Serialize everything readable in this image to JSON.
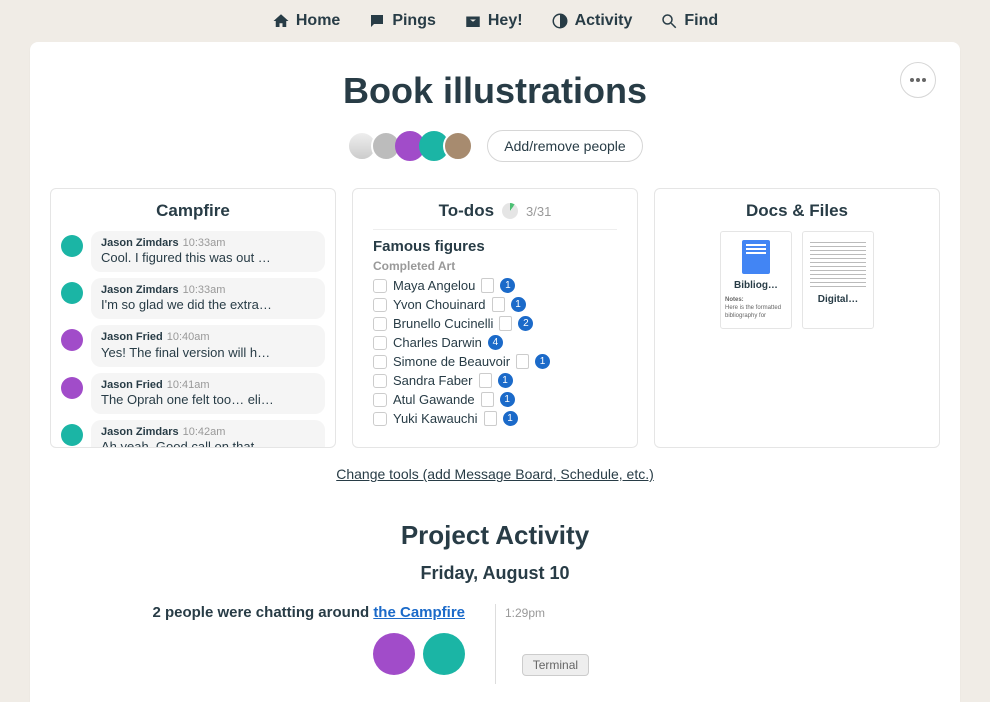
{
  "nav": {
    "home": "Home",
    "pings": "Pings",
    "hey": "Hey!",
    "activity": "Activity",
    "find": "Find"
  },
  "project": {
    "title": "Book illustrations",
    "add_people_label": "Add/remove people"
  },
  "campfire": {
    "title": "Campfire",
    "messages": [
      {
        "author": "Jason Zimdars",
        "time": "10:33am",
        "text": "Cool. I figured this was out …",
        "color": "green"
      },
      {
        "author": "Jason Zimdars",
        "time": "10:33am",
        "text": "I'm so glad we did the extra…",
        "color": "green"
      },
      {
        "author": "Jason Fried",
        "time": "10:40am",
        "text": "Yes! The final version will h…",
        "color": "purple"
      },
      {
        "author": "Jason Fried",
        "time": "10:41am",
        "text": "The Oprah one felt too… eli…",
        "color": "purple"
      },
      {
        "author": "Jason Zimdars",
        "time": "10:42am",
        "text": "Ah yeah. Good call on that",
        "color": "green"
      }
    ]
  },
  "todos": {
    "title": "To-dos",
    "count": "3/31",
    "section": "Famous figures",
    "subsection": "Completed Art",
    "items": [
      {
        "name": "Maya Angelou",
        "badge": "1"
      },
      {
        "name": "Yvon Chouinard",
        "badge": "1"
      },
      {
        "name": "Brunello Cucinelli",
        "badge": "2"
      },
      {
        "name": "Charles Darwin",
        "badge": "4",
        "nodoc": true
      },
      {
        "name": "Simone de Beauvoir",
        "badge": "1"
      },
      {
        "name": "Sandra Faber",
        "badge": "1"
      },
      {
        "name": "Atul Gawande",
        "badge": "1"
      },
      {
        "name": "Yuki Kawauchi",
        "badge": "1"
      }
    ]
  },
  "docs": {
    "title": "Docs & Files",
    "items": [
      {
        "title": "Bibliog…",
        "notes_label": "Notes:",
        "notes_text": "Here is the formatted bibliography for"
      },
      {
        "title": "Digital…"
      }
    ]
  },
  "change_link": "Change tools (add Message Board, Schedule, etc.)",
  "activity": {
    "header": "Project Activity",
    "date": "Friday, August 10",
    "line_prefix": "2 people were chatting around ",
    "line_link": "the Campfire",
    "time": "1:29pm"
  },
  "terminal_label": "Terminal"
}
